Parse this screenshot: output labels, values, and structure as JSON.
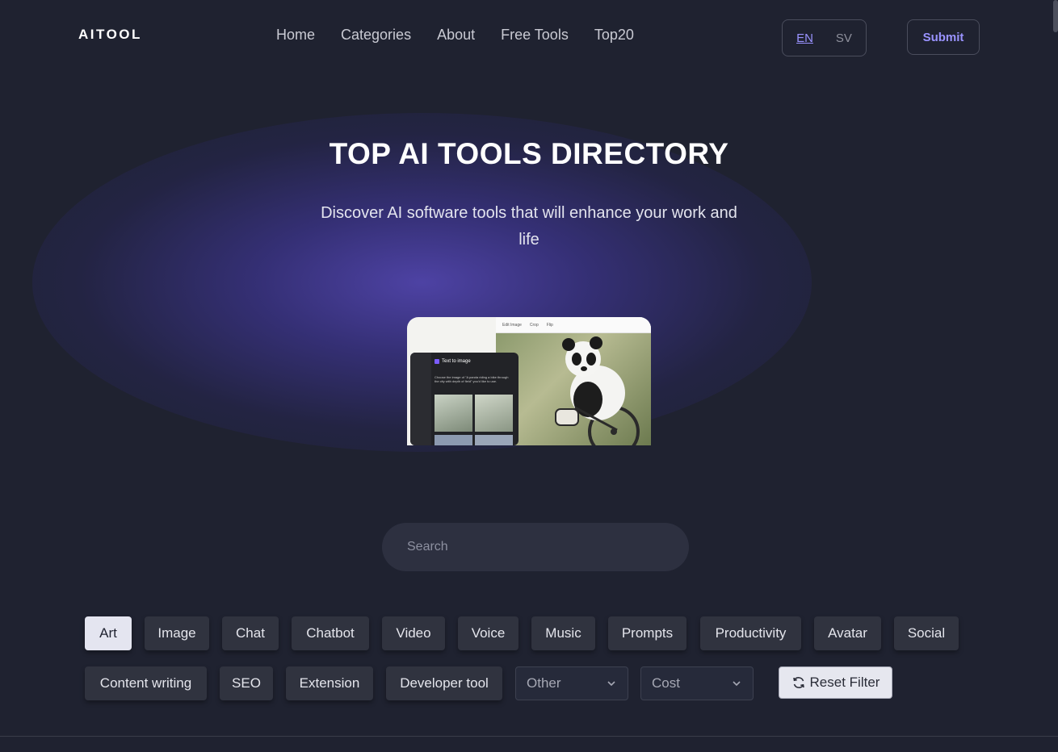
{
  "header": {
    "logo": "AITOOL",
    "nav": [
      "Home",
      "Categories",
      "About",
      "Free Tools",
      "Top20"
    ],
    "lang": {
      "active": "EN",
      "inactive": "SV"
    },
    "submit_label": "Submit"
  },
  "hero": {
    "title": "TOP AI TOOLS DIRECTORY",
    "subtitle": "Discover AI software tools that will enhance your work and life",
    "preview": {
      "tabs": [
        "Edit Image",
        "Crop",
        "Flip"
      ],
      "panel_title": "Text to image",
      "panel_desc": "Choose the image of \"A panda riding a bike through the city with depth of field\" you'd like to use."
    }
  },
  "search": {
    "placeholder": "Search",
    "value": ""
  },
  "filters": {
    "categories": [
      "Art",
      "Image",
      "Chat",
      "Chatbot",
      "Video",
      "Voice",
      "Music",
      "Prompts",
      "Productivity",
      "Avatar",
      "Social",
      "Content writing",
      "SEO",
      "Extension",
      "Developer tool"
    ],
    "active_category": "Art",
    "other_select": "Other",
    "cost_select": "Cost",
    "reset_label": "Reset Filter"
  },
  "colors": {
    "background": "#1f2230",
    "accent": "#9a93ff",
    "chip": "#30333f",
    "chip_active": "#e4e5f0"
  }
}
